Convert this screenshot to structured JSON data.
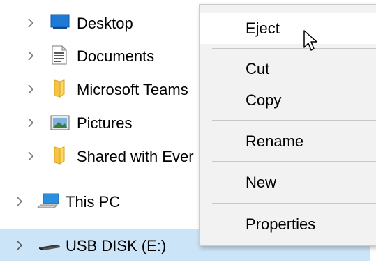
{
  "nav_tree": {
    "items": [
      {
        "label": "Desktop",
        "icon": "desktop-icon"
      },
      {
        "label": "Documents",
        "icon": "documents-icon"
      },
      {
        "label": "Microsoft Teams",
        "icon": "folder-icon"
      },
      {
        "label": "Pictures",
        "icon": "pictures-icon"
      },
      {
        "label": "Shared with Ever",
        "icon": "folder-icon"
      },
      {
        "label": "This PC",
        "icon": "this-pc-icon"
      },
      {
        "label": "USB DISK (E:)",
        "icon": "usb-drive-icon",
        "selected": true
      }
    ]
  },
  "context_menu": {
    "eject": "Eject",
    "cut": "Cut",
    "copy": "Copy",
    "rename": "Rename",
    "new": "New",
    "properties": "Properties"
  },
  "colors": {
    "selection": "#cce4f7",
    "menu_background": "#f2f2f2",
    "menu_hover": "#ffffff",
    "folder_yellow": "#f4c542",
    "desktop_blue": "#1e7ad6"
  }
}
